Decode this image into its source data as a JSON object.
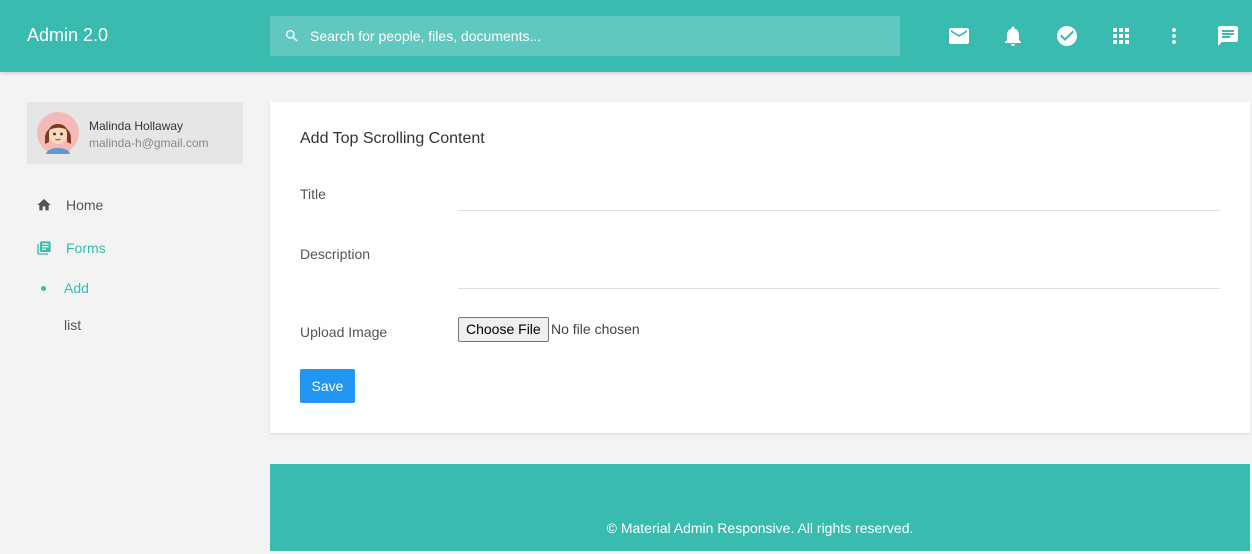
{
  "header": {
    "brand": "Admin 2.0",
    "search_placeholder": "Search for people, files, documents...",
    "icons": [
      "mail-icon",
      "bell-icon",
      "check-circle-icon",
      "apps-grid-icon",
      "more-vert-icon",
      "chat-icon"
    ]
  },
  "profile": {
    "name": "Malinda Hollaway",
    "email": "malinda-h@gmail.com"
  },
  "sidebar": {
    "items": [
      {
        "label": "Home",
        "icon": "home-icon"
      },
      {
        "label": "Forms",
        "icon": "forms-icon",
        "active": true
      }
    ],
    "subitems": [
      {
        "label": "Add",
        "active": true
      },
      {
        "label": "list"
      }
    ]
  },
  "form": {
    "title": "Add Top Scrolling Content",
    "fields": {
      "title_label": "Title",
      "title_value": "",
      "description_label": "Description",
      "description_value": "",
      "upload_label": "Upload Image",
      "choose_file_label": "Choose File",
      "file_status": "No file chosen"
    },
    "save_label": "Save"
  },
  "footer": {
    "text": "© Material Admin Responsive. All rights reserved."
  },
  "colors": {
    "accent": "#39bbb0",
    "primary_button": "#2196f3",
    "background": "#f3f3f3"
  }
}
